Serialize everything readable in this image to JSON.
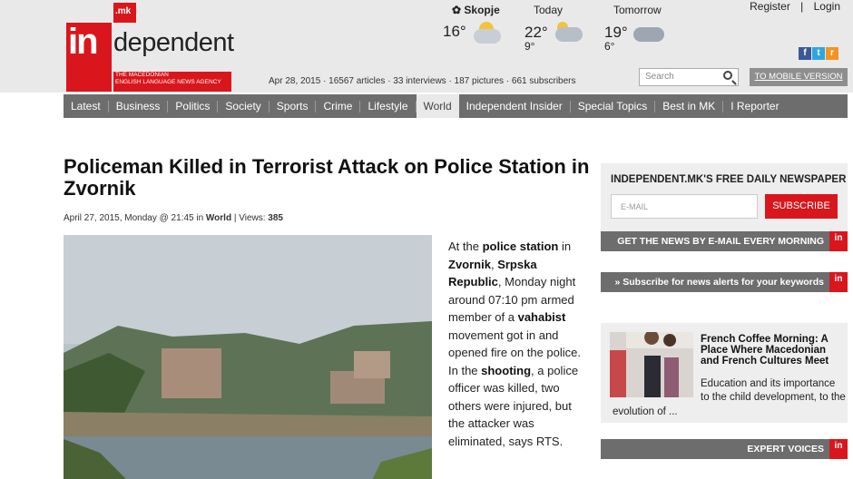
{
  "logo": {
    "mk": ".mk",
    "in": "in",
    "rest": "dependent",
    "tag_line1": "THE MACEDONIAN",
    "tag_line2": "ENGLISH LANGUAGE NEWS AGENCY",
    "brand_color": "#d9161c"
  },
  "weather": {
    "city": "Skopje",
    "city_temp": "16°",
    "today_label": "Today",
    "today_high": "22°",
    "today_low": "9°",
    "tomorrow_label": "Tomorrow",
    "tomorrow_high": "19°",
    "tomorrow_low": "6°"
  },
  "toplinks": {
    "register": "Register",
    "separator": "|",
    "login": "Login"
  },
  "social": {
    "facebook": "f",
    "twitter": "t",
    "rss": "r"
  },
  "stats": "Apr 28, 2015 · 16567 articles · 33 interviews · 187 pictures · 661 subscribers",
  "search": {
    "placeholder": "Search"
  },
  "mobile_button": "TO MOBILE VERSION",
  "nav": [
    "Latest",
    "Business",
    "Politics",
    "Society",
    "Sports",
    "Crime",
    "Lifestyle",
    "World",
    "Independent Insider",
    "Special Topics",
    "Best in MK",
    "I Reporter"
  ],
  "article": {
    "title": "Policeman Killed in Terrorist Attack on Police Station in Zvornik",
    "meta_date": "April 27, 2015, Monday @ 21:45 in ",
    "meta_category": "World",
    "meta_views_label": " | Views: ",
    "meta_views": "385",
    "p1": "At the ",
    "b1": "police station",
    "p2": " in ",
    "b2": "Zvornik",
    "p3": ", ",
    "b3": "Srpska Republic",
    "p4": ", Monday night around 07:10 pm armed member of  a ",
    "b4": "vahabist",
    "p5": " movement got in and opened fire on the police. In the ",
    "b5": "shooting",
    "p6": ", a police officer  was killed, two others were injured, but the attacker was eliminated, says RTS."
  },
  "sidebar": {
    "newspaper_head": "INDEPENDENT.MK'S FREE DAILY NEWSPAPER",
    "email_placeholder": "E-MAIL",
    "subscribe": "SUBSCRIBE",
    "bar1": "GET THE NEWS BY E-MAIL EVERY MORNING",
    "bar2": "» Subscribe for news alerts for your keywords",
    "bar3": "EXPERT VOICES",
    "in_badge": "in",
    "news_title": "French Coffee Morning: A Place Where Macedonian and French Cultures Meet",
    "news_text": "Education and its importance to the child development, to the",
    "news_text2": "evolution of ..."
  }
}
